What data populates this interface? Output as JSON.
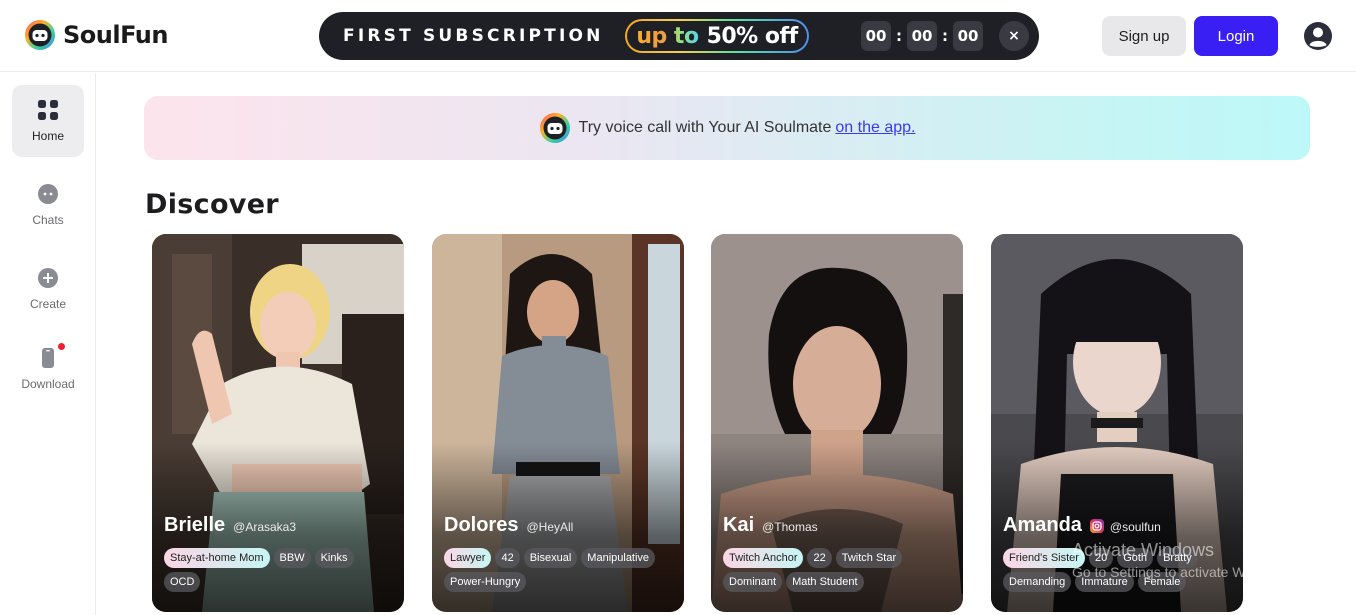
{
  "brand": {
    "name": "SoulFun",
    "logo_icon": "soulfun-logo-icon"
  },
  "promo": {
    "title": "FIRST SUBSCRIPTION",
    "discount_upto": "up to",
    "discount_value": "50% off",
    "timer": {
      "hours": "00",
      "minutes": "00",
      "seconds": "00"
    },
    "close_label": "×"
  },
  "auth": {
    "signup_label": "Sign up",
    "login_label": "Login",
    "profile_icon": "user-circle-icon"
  },
  "colors": {
    "accent": "#3a1ff5",
    "notification_dot": "#f0202e"
  },
  "sidebar": {
    "items": [
      {
        "label": "Home",
        "icon": "grid-icon",
        "active": true
      },
      {
        "label": "Chats",
        "icon": "chat-icon",
        "active": false
      },
      {
        "label": "Create",
        "icon": "plus-icon",
        "active": false
      },
      {
        "label": "Download",
        "icon": "phone-icon",
        "active": false,
        "badge_dot": true
      }
    ]
  },
  "banner": {
    "text": "Try voice call with Your AI Soulmate",
    "link_text": "on the app."
  },
  "discover": {
    "title": "Discover",
    "cards": [
      {
        "name": "Brielle",
        "handle": "@Arasaka3",
        "tags": [
          "Stay-at-home Mom",
          "BBW",
          "Kinks",
          "OCD"
        ]
      },
      {
        "name": "Dolores",
        "handle": "@HeyAll",
        "tags": [
          "Lawyer",
          "42",
          "Bisexual",
          "Manipulative",
          "Power-Hungry"
        ]
      },
      {
        "name": "Kai",
        "handle": "@Thomas",
        "tags": [
          "Twitch Anchor",
          "22",
          "Twitch Star",
          "Dominant",
          "Math Student"
        ]
      },
      {
        "name": "Amanda",
        "handle": "@soulfun",
        "instagram": true,
        "tags": [
          "Friend's Sister",
          "20",
          "Goth",
          "Bratty",
          "Demanding",
          "Immature",
          "Female"
        ]
      }
    ]
  },
  "watermark": {
    "line1": "Activate Windows",
    "line2": "Go to Settings to activate Windows."
  }
}
